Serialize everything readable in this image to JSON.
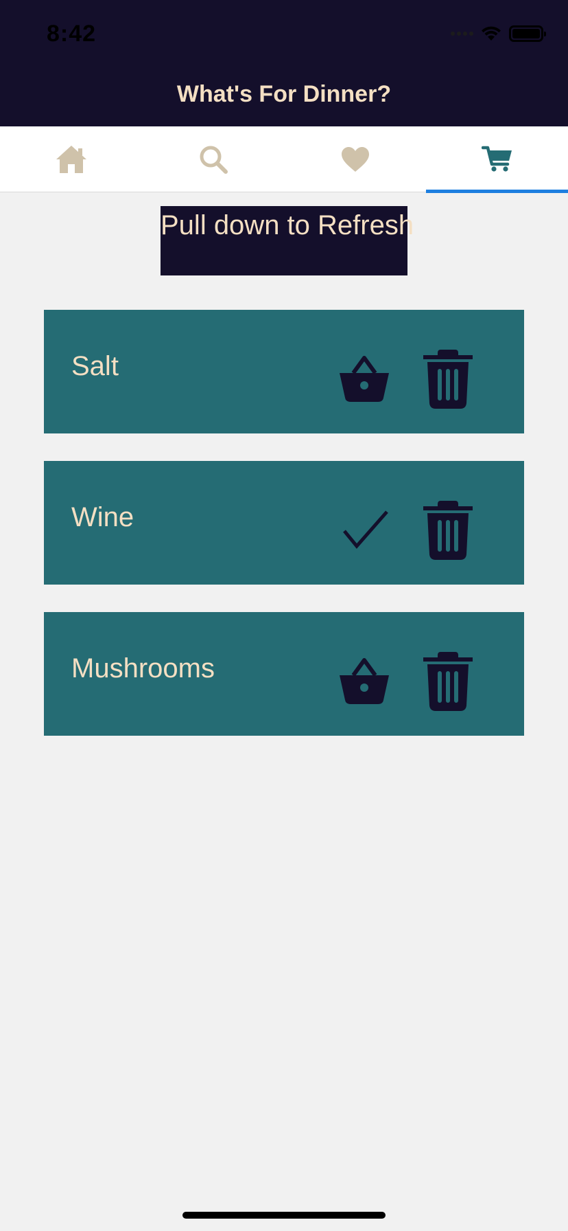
{
  "status_bar": {
    "time": "8:42"
  },
  "header": {
    "title": "What's For Dinner?"
  },
  "tabs": [
    {
      "icon": "home-icon",
      "active": false
    },
    {
      "icon": "search-icon",
      "active": false
    },
    {
      "icon": "heart-icon",
      "active": false
    },
    {
      "icon": "cart-icon",
      "active": true
    }
  ],
  "banner": {
    "text": "Pull down to Refresh"
  },
  "items": [
    {
      "label": "Salt",
      "status_icon": "basket-icon"
    },
    {
      "label": "Wine",
      "status_icon": "checkmark-icon"
    },
    {
      "label": "Mushrooms",
      "status_icon": "basket-icon"
    }
  ],
  "colors": {
    "header_bg": "#140f2b",
    "accent_text": "#f4dfc3",
    "item_bg": "#256c74",
    "tab_icon_inactive": "#cfc2aa",
    "tab_icon_active": "#256c74",
    "tab_indicator": "#1e7fe0"
  }
}
